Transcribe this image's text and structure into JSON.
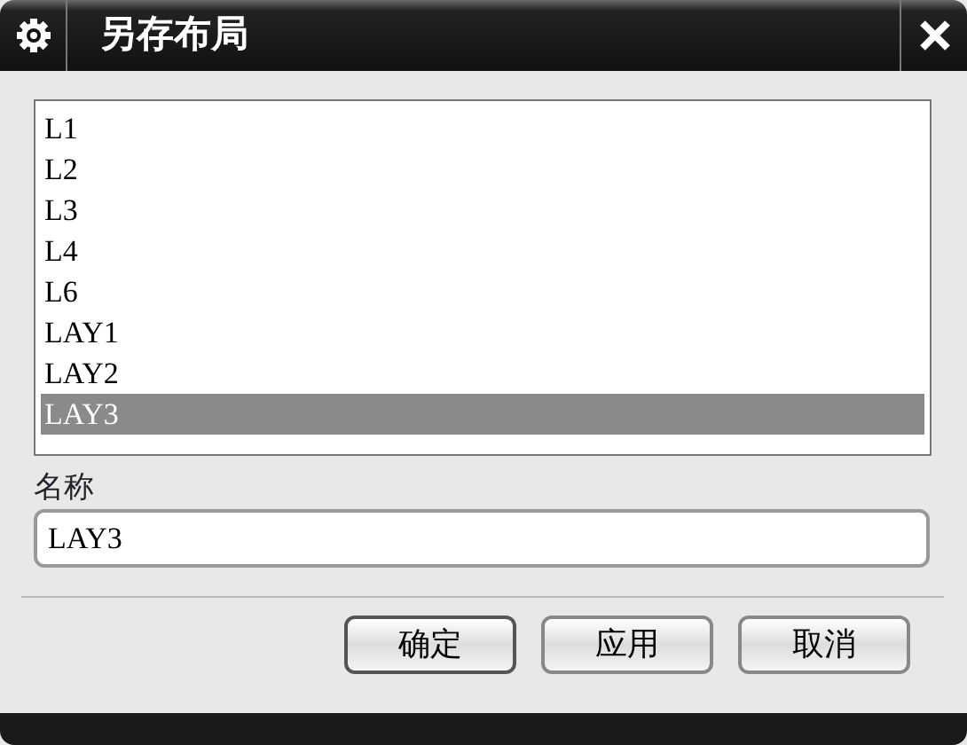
{
  "window": {
    "title": "另存布局"
  },
  "layouts": [
    {
      "label": "L1",
      "selected": false
    },
    {
      "label": "L2",
      "selected": false
    },
    {
      "label": "L3",
      "selected": false
    },
    {
      "label": "L4",
      "selected": false
    },
    {
      "label": "L6",
      "selected": false
    },
    {
      "label": "LAY1",
      "selected": false
    },
    {
      "label": "LAY2",
      "selected": false
    },
    {
      "label": "LAY3",
      "selected": true
    }
  ],
  "name_field": {
    "label": "名称",
    "value": "LAY3"
  },
  "buttons": [
    "确定",
    "应用",
    "取消"
  ]
}
